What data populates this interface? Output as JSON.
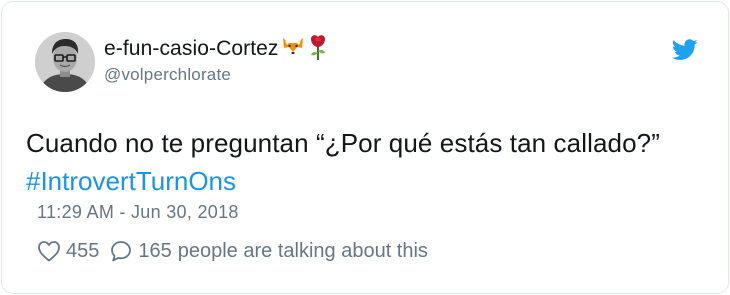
{
  "user": {
    "display_name": "e-fun-casio-Cortez",
    "emoji_1": "fox-face-icon",
    "emoji_2": "rose-icon",
    "handle": "@volperchlorate"
  },
  "tweet": {
    "text": "Cuando no te preguntan “¿Por qué estás tan callado?”",
    "hashtag": "#IntrovertTurnOns",
    "timestamp": "11:29 AM - Jun 30, 2018"
  },
  "actions": {
    "like_count": "455",
    "reply_count": "165",
    "talking_text": "people are talking about this"
  },
  "colors": {
    "text": "#14171a",
    "secondary": "#657786",
    "link": "#1b95e0",
    "twitter_blue": "#1da1f2",
    "border": "#e1e8ed"
  }
}
